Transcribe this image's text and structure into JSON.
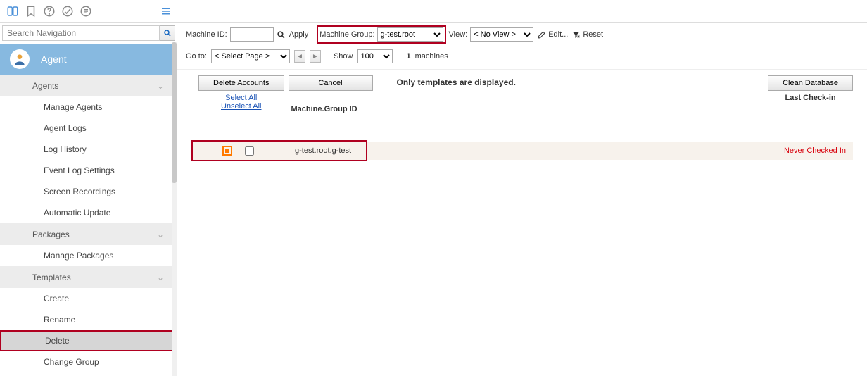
{
  "topbar": {
    "search_placeholder": "Search Navigation"
  },
  "sidebar": {
    "title": "Agent",
    "sections": [
      {
        "label": "Agents",
        "items": [
          "Manage Agents",
          "Agent Logs",
          "Log History",
          "Event Log Settings",
          "Screen Recordings",
          "Automatic Update"
        ]
      },
      {
        "label": "Packages",
        "items": [
          "Manage Packages"
        ]
      },
      {
        "label": "Templates",
        "items": [
          "Create",
          "Rename",
          "Delete",
          "Change Group"
        ]
      }
    ]
  },
  "filter": {
    "machine_id_label": "Machine ID:",
    "machine_id_value": "",
    "apply_label": "Apply",
    "machine_group_label": "Machine Group:",
    "machine_group_value": "g-test.root",
    "view_label": "View:",
    "view_value": "< No View >",
    "edit_label": "Edit...",
    "reset_label": "Reset"
  },
  "paging": {
    "goto_label": "Go to:",
    "goto_value": "< Select Page >",
    "show_label": "Show",
    "show_value": "100",
    "count_num": "1",
    "count_label": "machines"
  },
  "actions": {
    "delete_label": "Delete Accounts",
    "cancel_label": "Cancel",
    "select_all": "Select All",
    "unselect_all": "Unselect All",
    "notice": "Only templates are displayed",
    "col_machine": "Machine.Group ID",
    "clean_db": "Clean Database",
    "col_checkin": "Last Check-in"
  },
  "row": {
    "name": "g-test.root.g-test",
    "status": "Never Checked In"
  }
}
